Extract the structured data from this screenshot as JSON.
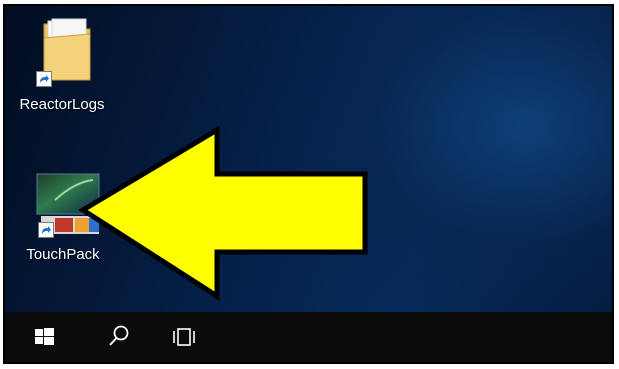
{
  "desktop": {
    "icons": [
      {
        "label": "ReactorLogs",
        "type": "folder-shortcut",
        "icon": "folder-icon"
      },
      {
        "label": "TouchPack",
        "type": "application-shortcut",
        "icon": "touchpack-app-icon"
      }
    ]
  },
  "annotation": {
    "type": "arrow",
    "direction": "left",
    "fill_color": "#ffff00",
    "stroke_color": "#000000",
    "points_to": "TouchPack"
  },
  "taskbar": {
    "buttons": [
      {
        "name": "start",
        "icon": "windows-logo-icon"
      },
      {
        "name": "search",
        "icon": "search-icon"
      },
      {
        "name": "task-view",
        "icon": "task-view-icon"
      }
    ],
    "background": "#0b0b0b"
  },
  "colors": {
    "desktop_dark": "#020d22",
    "desktop_light": "#0f3f78",
    "highlight_arrow": "#ffff00"
  }
}
